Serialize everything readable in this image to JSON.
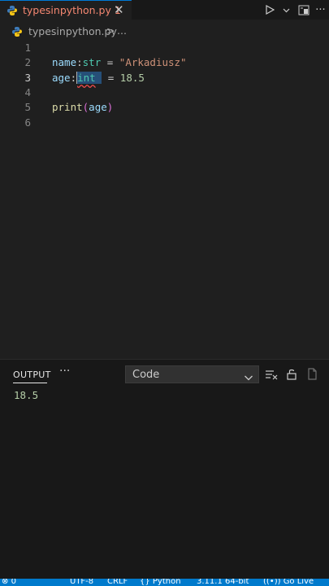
{
  "tab": {
    "filename": "typesinpython.py",
    "problems": "1",
    "close": "✕"
  },
  "breadcrumb": {
    "file": "typesinpython.py",
    "separator": ">",
    "more": "..."
  },
  "editor": {
    "line_numbers": [
      "1",
      "2",
      "3",
      "4",
      "5",
      "6"
    ],
    "line2": {
      "var": "name",
      "colon": ":",
      "type": "str",
      "eq": " = ",
      "value": "\"Arkadiusz\""
    },
    "line3": {
      "var": "age",
      "colon": ":",
      "type": "int",
      "eq": " = ",
      "value": "18.5"
    },
    "line5": {
      "func": "print",
      "open": "(",
      "arg": "age",
      "close": ")"
    }
  },
  "panel": {
    "tab_label": "OUTPUT",
    "more": "···",
    "channel": "Code",
    "output_text": "18.5"
  },
  "status_bar": {
    "errors": "0",
    "encoding": "UTF-8",
    "eol": "CRLF",
    "language": "Python",
    "interpreter": "3.11.1 64-bit",
    "live": "Go Live"
  },
  "colors": {
    "accent": "#007acc",
    "error": "#f48771",
    "background": "#1f1f1f"
  }
}
